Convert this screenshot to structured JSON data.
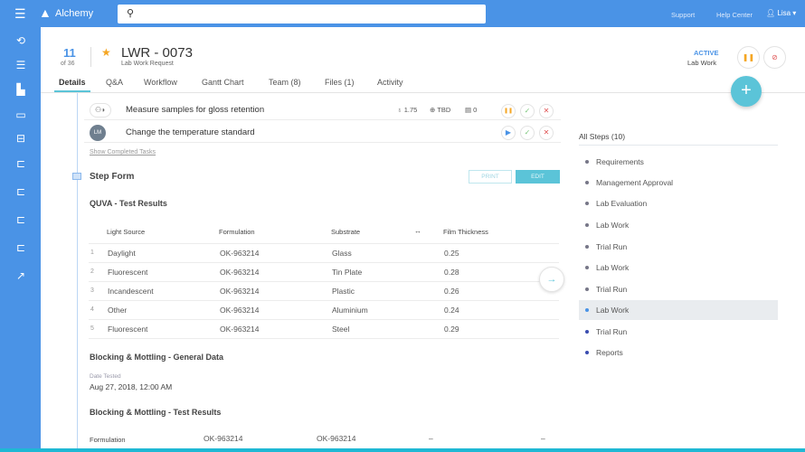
{
  "topbar": {
    "brand": "Alchemy",
    "search_placeholder": "",
    "support": "Support",
    "help_center": "Help Center",
    "user": "Lisa"
  },
  "sidebar": {
    "icons": [
      "history-icon",
      "checklist-icon",
      "factory-icon",
      "id-card-icon",
      "archive-icon",
      "folder-icon",
      "folder-icon",
      "folder-icon",
      "folder-icon",
      "chart-icon"
    ]
  },
  "record": {
    "index": "11",
    "of": "of 36",
    "title": "LWR - 0073",
    "subtitle": "Lab Work Request",
    "status": "ACTIVE",
    "stage": "Lab Work"
  },
  "tabs": [
    "Details",
    "Q&A",
    "Workflow",
    "Gantt Chart",
    "Team (8)",
    "Files (1)",
    "Activity"
  ],
  "tasks": [
    {
      "title": "Measure samples for gloss retention",
      "hours": "1.75",
      "due": "TBD",
      "comments": "0"
    },
    {
      "title": "Change the temperature standard",
      "avatar": "LM"
    }
  ],
  "show_completed": "Show Completed Tasks",
  "step_form": {
    "title": "Step Form",
    "print": "PRINT",
    "edit": "EDIT"
  },
  "quva": {
    "title": "QUVA - Test Results",
    "columns": [
      "Light Source",
      "Formulation",
      "Substrate",
      "Film Thickness"
    ],
    "rows": [
      {
        "n": "1",
        "light": "Daylight",
        "form": "OK-963214",
        "sub": "Glass",
        "film": "0.25"
      },
      {
        "n": "2",
        "light": "Fluorescent",
        "form": "OK-963214",
        "sub": "Tin Plate",
        "film": "0.28"
      },
      {
        "n": "3",
        "light": "Incandescent",
        "form": "OK-963214",
        "sub": "Plastic",
        "film": "0.26"
      },
      {
        "n": "4",
        "light": "Other",
        "form": "OK-963214",
        "sub": "Aluminium",
        "film": "0.24"
      },
      {
        "n": "5",
        "light": "Fluorescent",
        "form": "OK-963214",
        "sub": "Steel",
        "film": "0.29"
      }
    ]
  },
  "blocking_general": {
    "title": "Blocking & Mottling - General Data",
    "date_label": "Date Tested",
    "date_value": "Aug 27, 2018, 12:00 AM"
  },
  "blocking_results": {
    "title": "Blocking & Mottling - Test Results",
    "row_label": "Formulation",
    "values": [
      "OK-963214",
      "OK-963214",
      "–",
      "–"
    ]
  },
  "steps": {
    "title": "All Steps (10)",
    "items": [
      "Requirements",
      "Management Approval",
      "Lab Evaluation",
      "Lab Work",
      "Trial Run",
      "Lab Work",
      "Trial Run",
      "Lab Work",
      "Trial Run",
      "Reports"
    ],
    "active_index": 7
  },
  "colors": {
    "brand": "#4a93e6",
    "accent": "#5bc4d8",
    "star": "#f5a623",
    "pause": "#f5a623",
    "reject": "#e05555",
    "approve": "#7cc67c"
  }
}
